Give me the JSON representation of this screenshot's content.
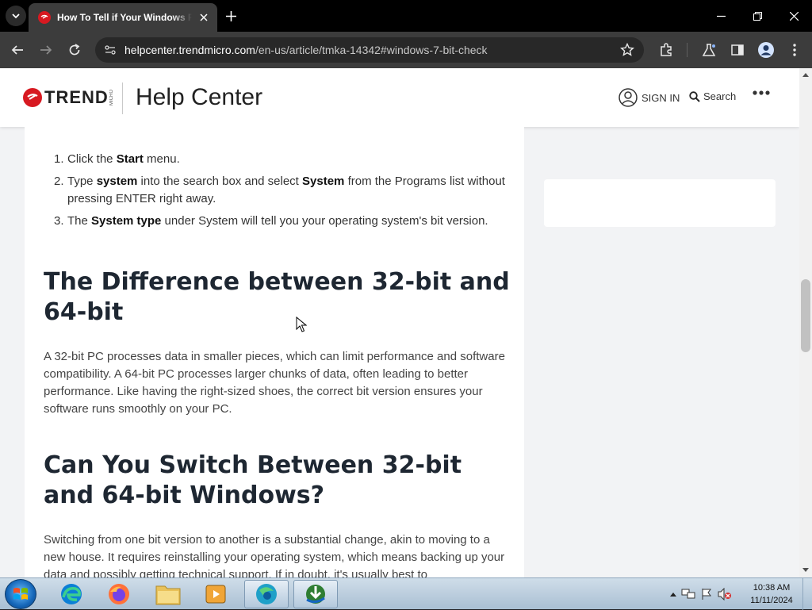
{
  "browser": {
    "tab_title": "How To Tell if Your Windows PC",
    "url_host": "helpcenter.trendmicro.com",
    "url_path": "/en-us/article/tmka-14342#windows-7-bit-check"
  },
  "header": {
    "logo_text": "TREND",
    "logo_micro": "MICRO",
    "title": "Help Center",
    "signin": "SIGN IN",
    "search": "Search"
  },
  "steps": [
    {
      "num": "1.",
      "pre": "Click the ",
      "b1": "Start",
      "mid": " menu.",
      "b2": "",
      "post": ""
    },
    {
      "num": "2.",
      "pre": "Type ",
      "b1": "system",
      "mid": " into the search box and select ",
      "b2": "System",
      "post": " from the Programs list without pressing ENTER right away."
    },
    {
      "num": "3.",
      "pre": "The ",
      "b1": "System type",
      "mid": " under System will tell you your operating system's bit version.",
      "b2": "",
      "post": ""
    }
  ],
  "sections": [
    {
      "heading": "The Difference between 32-bit and 64-bit",
      "body": "A 32-bit PC processes data in smaller pieces, which can limit performance and software compatibility. A 64-bit PC processes larger chunks of data, often leading to better performance. Like having the right-sized shoes, the correct bit version ensures your software runs smoothly on your PC."
    },
    {
      "heading": "Can You Switch Between 32-bit and 64-bit Windows?",
      "body": "Switching from one bit version to another is a substantial change, akin to moving to a new house. It requires reinstalling your operating system, which means backing up your data and possibly getting technical support. If in doubt, it's usually best to"
    }
  ],
  "taskbar": {
    "time": "10:38 AM",
    "date": "11/11/2024"
  }
}
